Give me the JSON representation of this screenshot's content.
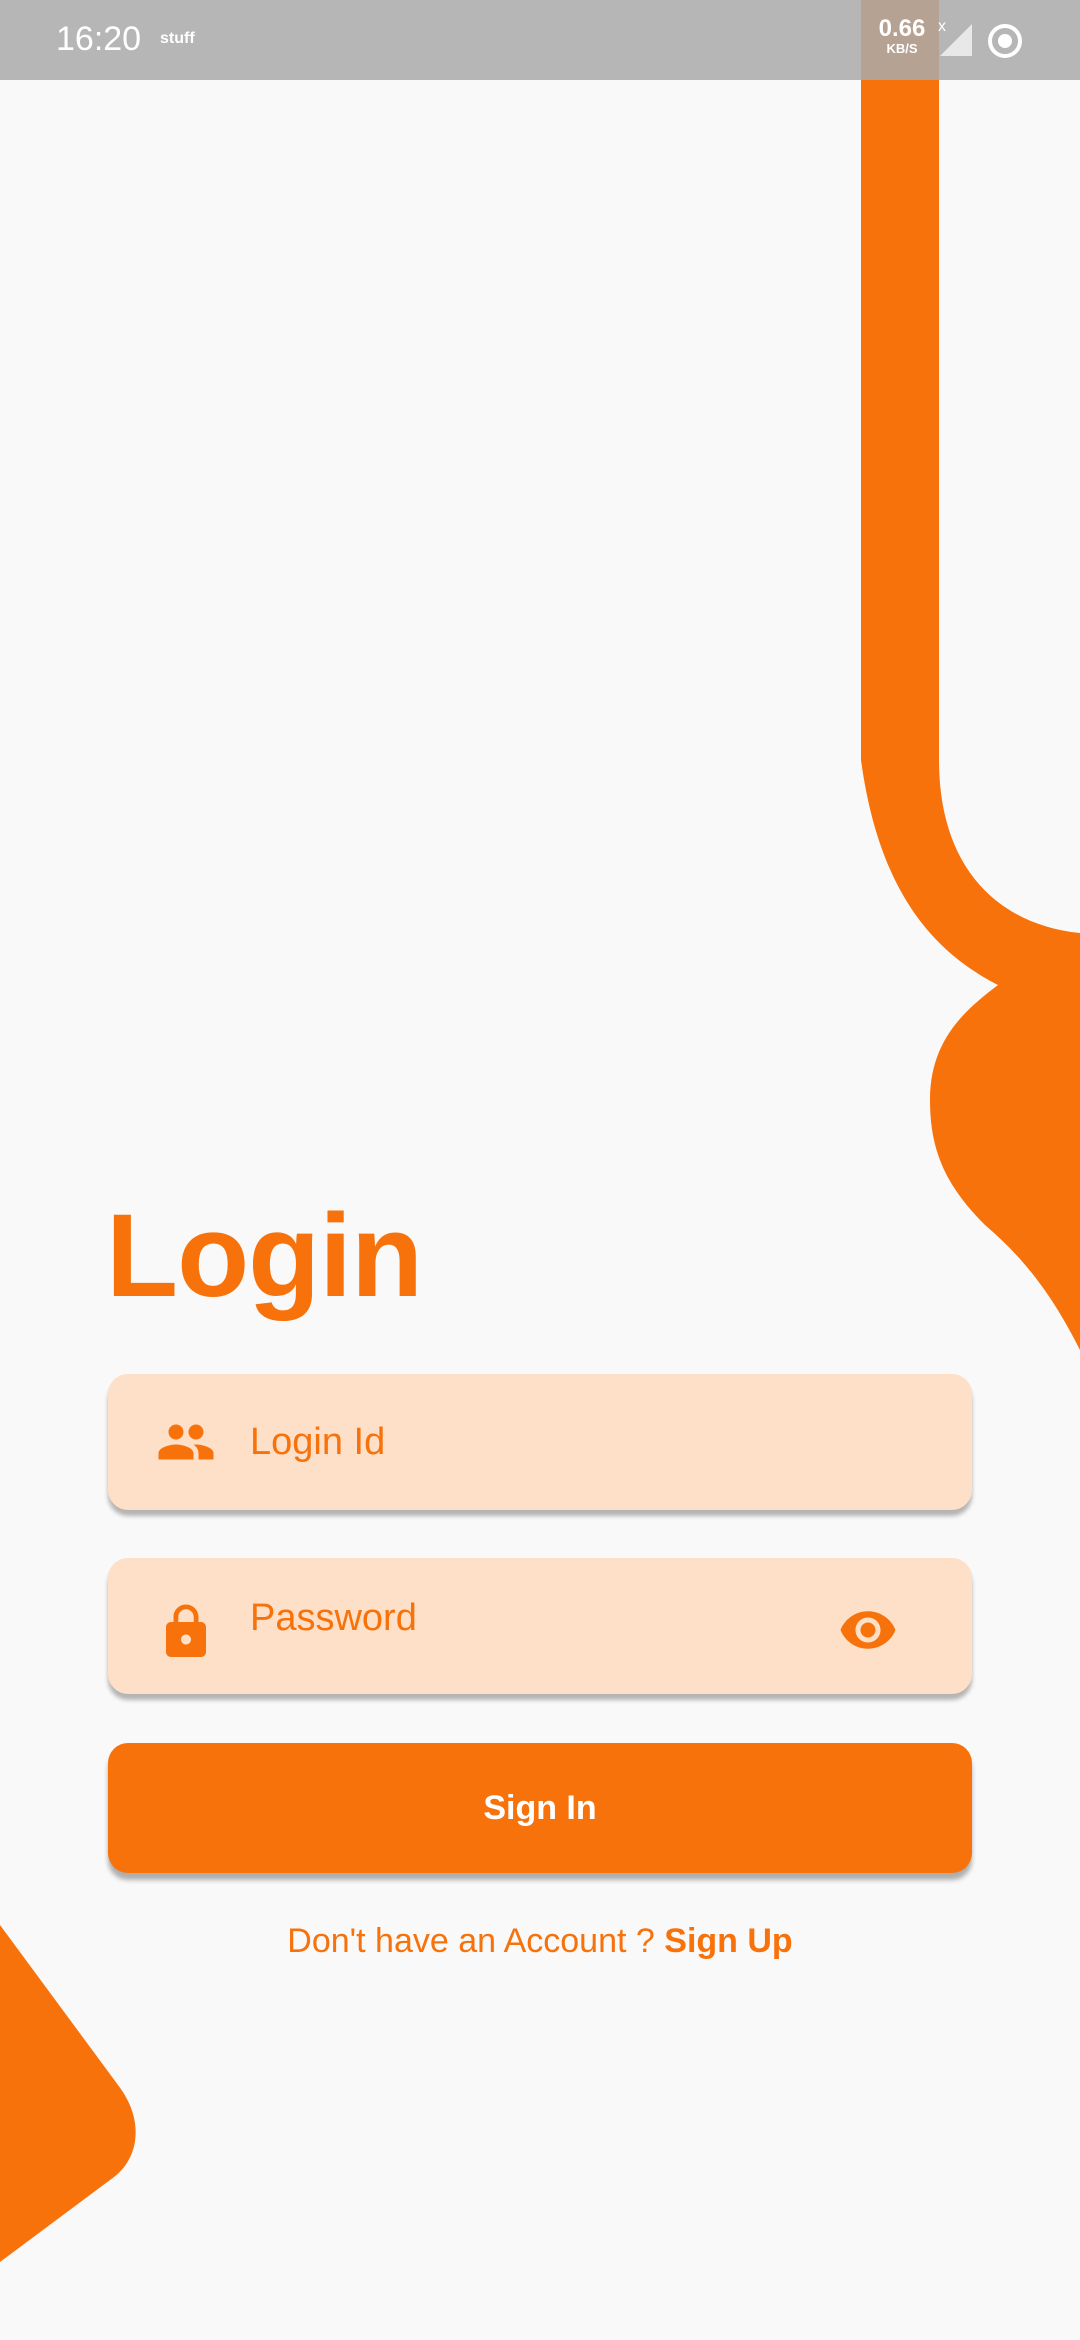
{
  "status_bar": {
    "time": "16:20",
    "app_label": "stuff",
    "net_speed_value": "0.66",
    "net_speed_unit": "KB/S",
    "signal_mark": "x"
  },
  "login": {
    "title": "Login",
    "login_id_placeholder": "Login Id",
    "password_placeholder": "Password",
    "sign_in_label": "Sign In",
    "no_account_text": "Don't have an Account ? ",
    "sign_up_label": "Sign Up"
  },
  "icons": {
    "login_field": "people-icon",
    "password_field": "lock-icon",
    "password_visibility": "eye-icon"
  },
  "colors": {
    "accent": "#f8720c",
    "field_background": "#fedfc7",
    "page_background": "#f9f9f9",
    "status_bar": "#aaaaaa"
  }
}
